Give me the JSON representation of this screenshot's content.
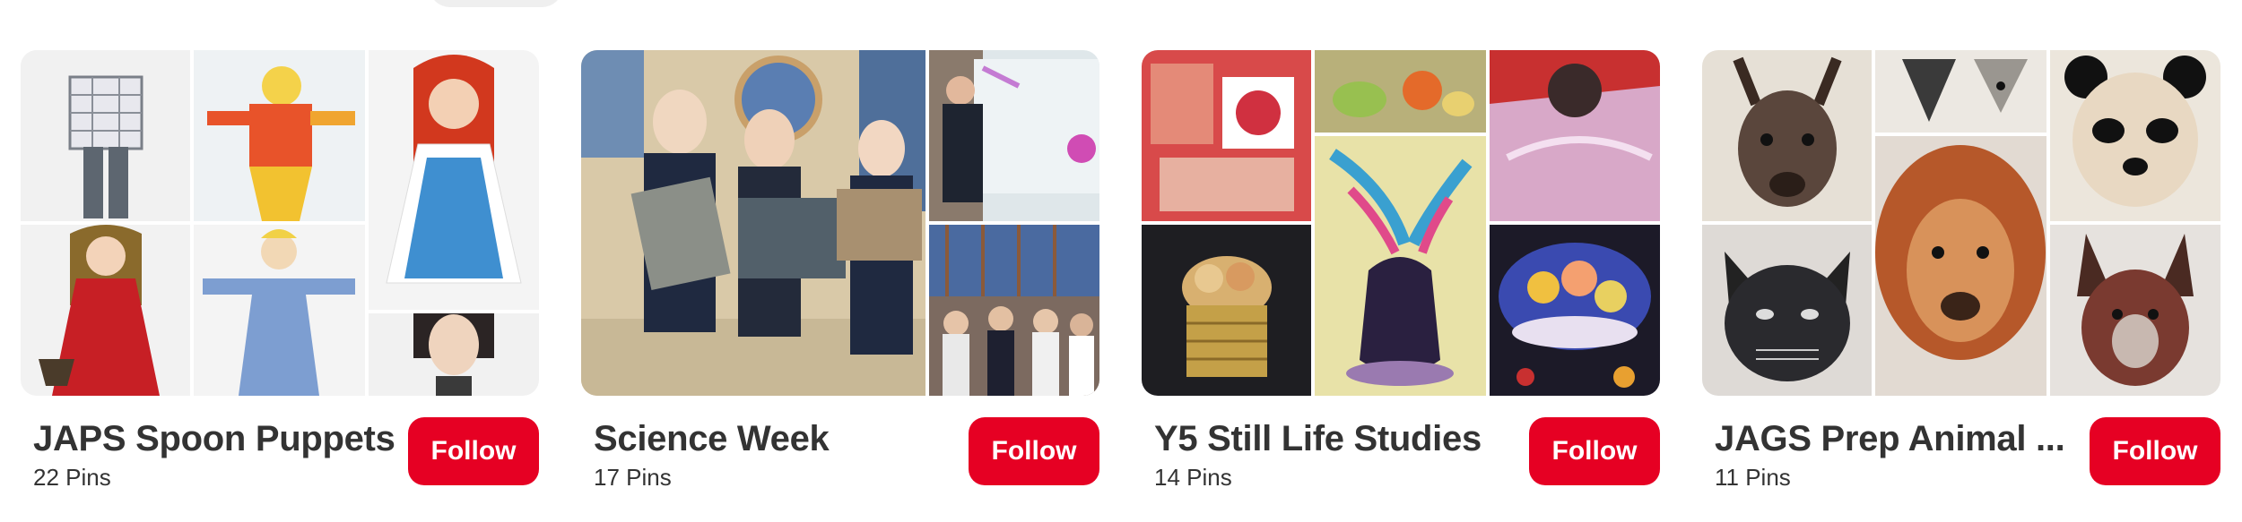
{
  "boards": [
    {
      "title": "JAPS Spoon Puppets",
      "pins": "22 Pins",
      "follow_label": "Follow"
    },
    {
      "title": "Science Week",
      "pins": "17 Pins",
      "follow_label": "Follow"
    },
    {
      "title": "Y5 Still Life Studies",
      "pins": "14 Pins",
      "follow_label": "Follow"
    },
    {
      "title": "JAGS Prep Animal ...",
      "pins": "11 Pins",
      "follow_label": "Follow"
    }
  ],
  "accent_color": "#e60023"
}
